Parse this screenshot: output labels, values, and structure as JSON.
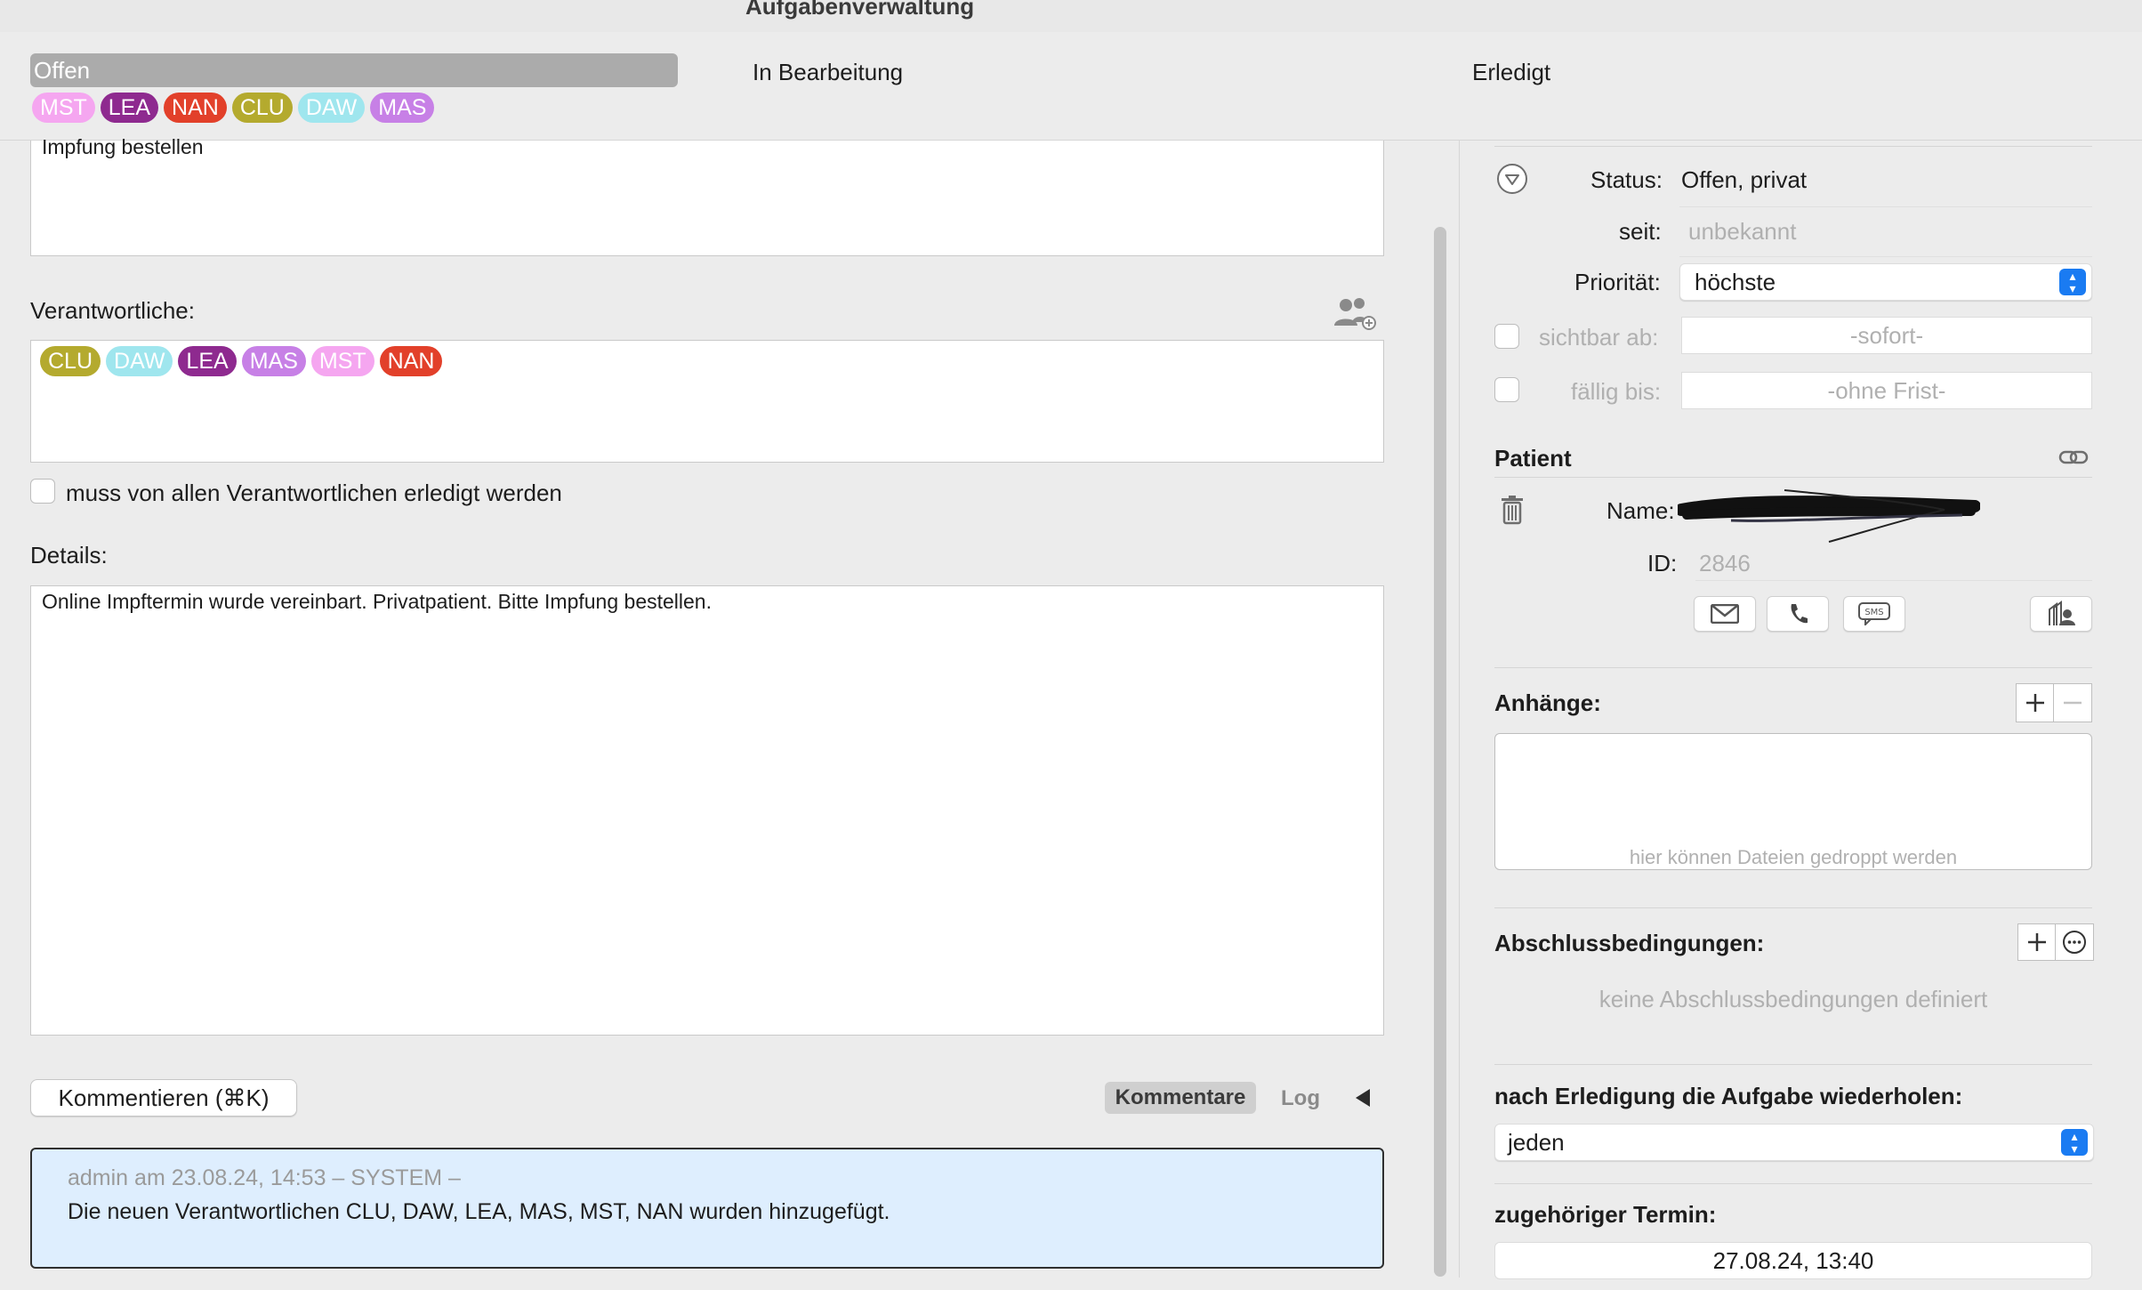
{
  "window": {
    "title": "Aufgabenverwaltung"
  },
  "columns": {
    "open": "Offen",
    "in_progress": "In Bearbeitung",
    "done": "Erledigt",
    "open_tags": [
      "MST",
      "LEA",
      "NAN",
      "CLU",
      "DAW",
      "MAS"
    ]
  },
  "task": {
    "title_text": "Impfung bestellen",
    "responsible_label": "Verantwortliche:",
    "responsible_tags": [
      "CLU",
      "DAW",
      "LEA",
      "MAS",
      "MST",
      "NAN"
    ],
    "all_must_complete_label": "muss von allen Verantwortlichen erledigt werden",
    "details_label": "Details:",
    "details_text": "Online Impftermin wurde vereinbart.  Privatpatient. Bitte Impfung bestellen.",
    "comment_button": "Kommentieren (⌘K)",
    "tab_comments": "Kommentare",
    "tab_log": "Log"
  },
  "comment": {
    "meta": "admin am 23.08.24, 14:53 – SYSTEM –",
    "text": "Die neuen Verantwortlichen CLU, DAW, LEA, MAS, MST, NAN wurden hinzugefügt."
  },
  "sidebar": {
    "status_label": "Status:",
    "status_value": "Offen, privat",
    "since_label": "seit:",
    "since_value": "unbekannt",
    "priority_label": "Priorität:",
    "priority_value": "höchste",
    "visible_from_label": "sichtbar ab:",
    "visible_from_value": "-sofort-",
    "due_label": "fällig bis:",
    "due_value": "-ohne Frist-",
    "patient_header": "Patient",
    "name_label": "Name:",
    "id_label": "ID:",
    "id_value": "2846",
    "attachments_header": "Anhänge:",
    "attachments_hint": "hier können Dateien gedroppt werden",
    "conditions_header": "Abschlussbedingungen:",
    "conditions_empty": "keine Abschlussbedingungen definiert",
    "repeat_header": "nach Erledigung die Aufgabe wiederholen:",
    "repeat_value": "jeden",
    "appointment_header": "zugehöriger Termin:",
    "appointment_value": "27.08.24, 13:40"
  },
  "tag_colors": {
    "MST": "#f5a6f0",
    "LEA": "#8e2a8f",
    "NAN": "#e2402a",
    "CLU": "#b4aa2e",
    "DAW": "#9fe6ee",
    "MAS": "#c780e6"
  }
}
